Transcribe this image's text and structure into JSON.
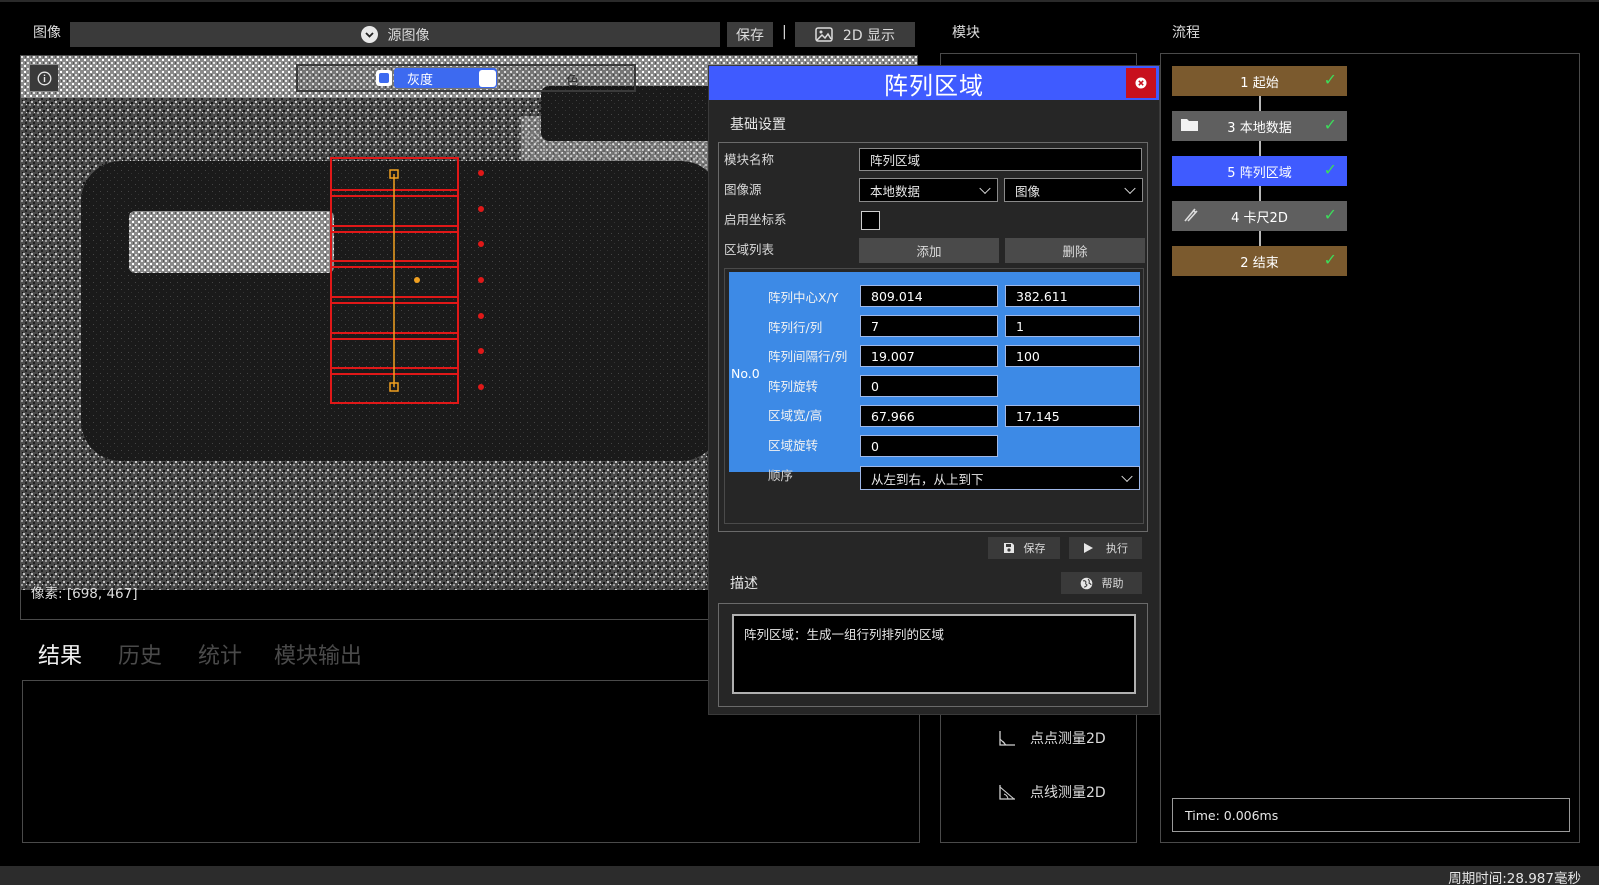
{
  "image_panel": {
    "title": "图像",
    "source_label": "源图像",
    "save_label": "保存",
    "separator": "|",
    "display_2d_label": "2D 显示",
    "overlay": {
      "gray_label": "灰度",
      "color_label": "色"
    },
    "pixel_readout": "像素: [698, 467]"
  },
  "result_tabs": [
    "结果",
    "历史",
    "统计",
    "模块输出"
  ],
  "modules_panel": {
    "title": "模块",
    "items": [
      {
        "label": "点点测量2D",
        "icon": "angle-measure-icon"
      },
      {
        "label": "点线测量2D",
        "icon": "angle-line-measure-icon"
      }
    ]
  },
  "flow_panel": {
    "title": "流程",
    "nodes": [
      {
        "label": "1 起始",
        "color": "#7b5a2e",
        "icon": null
      },
      {
        "label": "3 本地数据",
        "color": "#5f5f5f",
        "icon": "folder-icon"
      },
      {
        "label": "5 阵列区域",
        "color": "#3f5bff",
        "icon": null
      },
      {
        "label": "4 卡尺2D",
        "color": "#5f5f5f",
        "icon": "caliper-icon"
      },
      {
        "label": "2 结束",
        "color": "#7b5a2e",
        "icon": null
      }
    ],
    "check": "✓",
    "time_text": "Time: 0.006ms"
  },
  "dialog": {
    "title": "阵列区域",
    "section_basic": "基础设置",
    "module_name_label": "模块名称",
    "module_name_value": "阵列区域",
    "image_source_label": "图像源",
    "image_source_value": "本地数据",
    "image_source_type": "图像",
    "enable_coord_label": "启用坐标系",
    "enable_coord_checked": false,
    "region_list_label": "区域列表",
    "add_label": "添加",
    "delete_label": "删除",
    "region_index": "No.0",
    "rows": [
      {
        "label": "阵列中心X/Y",
        "v1": "809.014",
        "v2": "382.611"
      },
      {
        "label": "阵列行/列",
        "v1": "7",
        "v2": "1"
      },
      {
        "label": "阵列间隔行/列",
        "v1": "19.007",
        "v2": "100"
      },
      {
        "label": "阵列旋转",
        "v1": "0",
        "v2": null
      },
      {
        "label": "区域宽/高",
        "v1": "67.966",
        "v2": "17.145"
      },
      {
        "label": "区域旋转",
        "v1": "0",
        "v2": null
      }
    ],
    "order_label": "顺序",
    "order_value": "从左到右，从上到下",
    "save_label": "保存",
    "run_label": "执行",
    "section_desc": "描述",
    "help_label": "帮助",
    "description": "阵列区域：生成一组行列排列的区域"
  },
  "status_bar": {
    "cycle_time": "周期时间:28.987毫秒"
  },
  "colors": {
    "accent_blue": "#3d8ae6",
    "title_blue": "#3f5bff",
    "roi_red": "#e01818",
    "close_red": "#c8101e"
  }
}
